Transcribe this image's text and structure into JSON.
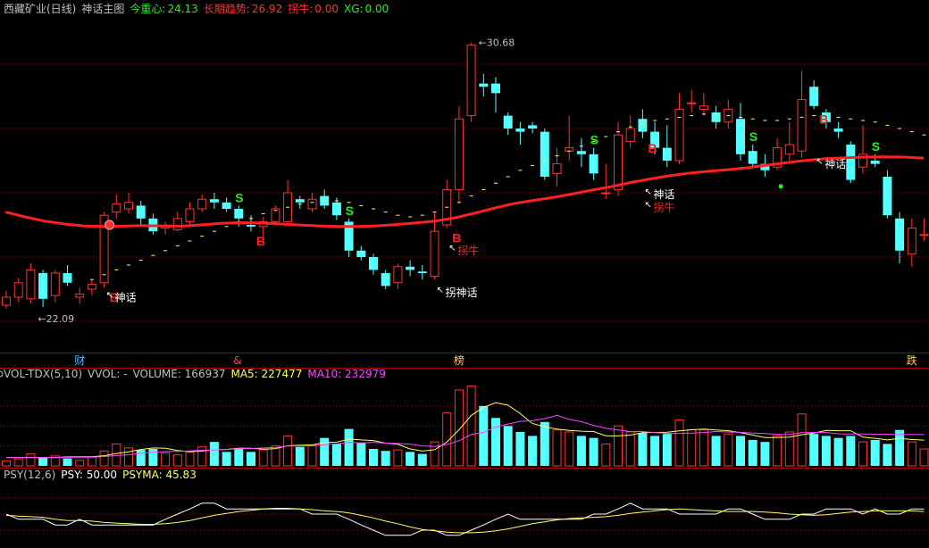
{
  "header": {
    "stock_name": "西藏矿业(日线)",
    "indicator_name": "神话主图",
    "center_label": "今重心:",
    "center_value": "24.13",
    "trend_label": "长期趋势:",
    "trend_value": "26.92",
    "guainiu_label": "拐牛:",
    "guainiu_value": "0.00",
    "xg_label": "XG:",
    "xg_value": "0.00"
  },
  "vol_header": {
    "name": "VOL-TDX(5,10)",
    "vvol": "VVOL: -",
    "volume": "VOLUME: 166937",
    "ma5": "MA5: 227477",
    "ma10": "MA10: 232979"
  },
  "psy_header": {
    "name": "PSY(12,6)",
    "psy": "PSY: 50.00",
    "psyma": "PSYMA: 45.83"
  },
  "colors": {
    "up": "#ff3232",
    "down": "#54ffff",
    "trend": "#ff2020",
    "dots": "#ffff66",
    "ma5": "#ffff66",
    "ma10": "#ff44ff",
    "psy": "#ffffff",
    "psyma": "#ffff66",
    "grid": "#8b0000",
    "signal_s": "#22ee22",
    "signal_b": "#ff2020",
    "label": "#ffffff"
  },
  "chart_data": {
    "type": "candlestick",
    "ylim": [
      21,
      31.5
    ],
    "vol_max": 420000,
    "psy_range": [
      0,
      100
    ],
    "candles": [
      [
        22.5,
        22.75,
        22.4,
        22.95
      ],
      [
        22.75,
        23.2,
        22.6,
        23.35
      ],
      [
        22.7,
        23.6,
        22.55,
        23.8
      ],
      [
        23.5,
        22.7,
        22.45,
        23.6
      ],
      [
        22.8,
        23.5,
        22.6,
        23.6
      ],
      [
        23.5,
        23.2,
        23.1,
        23.75
      ],
      [
        22.75,
        22.85,
        22.55,
        23.05
      ],
      [
        23.0,
        23.15,
        22.8,
        23.3
      ],
      [
        23.2,
        25.3,
        23.05,
        25.4
      ],
      [
        25.4,
        25.65,
        25.2,
        25.95
      ],
      [
        25.5,
        25.7,
        25.35,
        26.0
      ],
      [
        25.6,
        25.2,
        25.0,
        25.75
      ],
      [
        25.2,
        24.8,
        24.7,
        25.35
      ],
      [
        24.9,
        24.95,
        24.7,
        25.1
      ],
      [
        24.85,
        25.2,
        24.8,
        25.4
      ],
      [
        25.1,
        25.5,
        25.0,
        25.7
      ],
      [
        25.5,
        25.8,
        25.4,
        25.95
      ],
      [
        25.8,
        25.7,
        25.5,
        26.0
      ],
      [
        25.7,
        25.5,
        25.4,
        25.85
      ],
      [
        25.5,
        25.2,
        24.95,
        25.6
      ],
      [
        25.0,
        24.95,
        24.8,
        25.3
      ],
      [
        24.95,
        25.1,
        24.6,
        25.25
      ],
      [
        25.1,
        25.5,
        25.0,
        25.6
      ],
      [
        25.1,
        26.0,
        25.0,
        26.4
      ],
      [
        25.8,
        25.7,
        25.5,
        25.9
      ],
      [
        25.5,
        25.8,
        25.4,
        26.0
      ],
      [
        25.9,
        25.6,
        25.5,
        26.1
      ],
      [
        25.7,
        25.3,
        25.15,
        25.85
      ],
      [
        25.1,
        24.2,
        24.0,
        25.2
      ],
      [
        24.2,
        24.0,
        23.9,
        24.35
      ],
      [
        24.0,
        23.6,
        23.45,
        24.1
      ],
      [
        23.5,
        23.1,
        23.0,
        23.6
      ],
      [
        23.2,
        23.7,
        23.0,
        23.8
      ],
      [
        23.7,
        23.6,
        23.4,
        23.9
      ],
      [
        23.55,
        23.5,
        23.3,
        23.75
      ],
      [
        23.4,
        24.8,
        23.3,
        25.4
      ],
      [
        25.0,
        26.1,
        24.9,
        26.4
      ],
      [
        26.1,
        28.3,
        25.7,
        28.7
      ],
      [
        28.4,
        30.6,
        28.2,
        30.68
      ],
      [
        29.4,
        29.3,
        29.0,
        29.7
      ],
      [
        29.4,
        29.1,
        28.5,
        29.6
      ],
      [
        28.4,
        28.0,
        27.8,
        28.5
      ],
      [
        28.0,
        27.9,
        27.5,
        28.2
      ],
      [
        28.1,
        28.0,
        27.85,
        28.2
      ],
      [
        27.9,
        26.5,
        26.4,
        28.0
      ],
      [
        26.6,
        26.9,
        26.2,
        27.4
      ],
      [
        27.3,
        27.4,
        27.0,
        28.4
      ],
      [
        27.3,
        27.2,
        26.8,
        27.7
      ],
      [
        27.2,
        26.6,
        26.4,
        27.4
      ],
      [
        26.0,
        26.0,
        25.8,
        26.9
      ],
      [
        26.1,
        27.8,
        25.9,
        28.2
      ],
      [
        27.6,
        28.0,
        27.4,
        28.4
      ],
      [
        28.3,
        27.9,
        27.7,
        28.6
      ],
      [
        27.9,
        27.4,
        27.2,
        28.2
      ],
      [
        27.4,
        27.0,
        26.8,
        28.1
      ],
      [
        27.0,
        28.6,
        26.9,
        29.1
      ],
      [
        28.8,
        28.8,
        28.5,
        29.2
      ],
      [
        28.6,
        28.7,
        28.4,
        29.1
      ],
      [
        28.5,
        28.2,
        28.0,
        28.7
      ],
      [
        28.2,
        28.6,
        28.0,
        28.9
      ],
      [
        28.3,
        27.2,
        27.0,
        28.8
      ],
      [
        27.3,
        26.9,
        26.8,
        27.5
      ],
      [
        26.9,
        26.7,
        26.5,
        27.2
      ],
      [
        26.8,
        27.4,
        26.7,
        27.7
      ],
      [
        27.2,
        27.5,
        27.0,
        28.2
      ],
      [
        27.3,
        28.9,
        27.1,
        29.8
      ],
      [
        29.3,
        28.7,
        28.6,
        29.5
      ],
      [
        28.5,
        28.2,
        28.0,
        28.6
      ],
      [
        28.0,
        27.9,
        27.7,
        28.2
      ],
      [
        27.5,
        26.4,
        26.3,
        27.6
      ],
      [
        26.8,
        27.2,
        26.6,
        28.1
      ],
      [
        27.0,
        26.9,
        26.8,
        27.2
      ],
      [
        26.5,
        25.3,
        25.2,
        26.7
      ],
      [
        25.2,
        24.2,
        23.8,
        25.4
      ],
      [
        24.1,
        24.9,
        23.7,
        25.2
      ],
      [
        24.7,
        24.7,
        24.5,
        25.2
      ]
    ],
    "trend": [
      25.4,
      25.25,
      25.12,
      25.03,
      24.97,
      24.95,
      24.96,
      24.98,
      24.97,
      24.96,
      25.0,
      25.05,
      25.07,
      25.06,
      25.03,
      25.0,
      24.97,
      24.95,
      24.95,
      24.97,
      25.01,
      25.06,
      25.12,
      25.22,
      25.36,
      25.52,
      25.66,
      25.76,
      25.85,
      25.96,
      26.08,
      26.19,
      26.32,
      26.43,
      26.53,
      26.61,
      26.67,
      26.72,
      26.78,
      26.86,
      26.94,
      27.01,
      27.06,
      27.09,
      27.11,
      27.12,
      27.11,
      27.08
    ],
    "dots": [
      [
        7,
        23.3
      ],
      [
        8,
        23.45
      ],
      [
        9,
        23.6
      ],
      [
        10,
        23.75
      ],
      [
        11,
        23.9
      ],
      [
        12,
        24.05
      ],
      [
        13,
        24.2
      ],
      [
        14,
        24.35
      ],
      [
        15,
        24.5
      ],
      [
        16,
        24.65
      ],
      [
        17,
        24.8
      ],
      [
        18,
        24.95
      ],
      [
        19,
        25.1
      ],
      [
        20,
        25.2
      ],
      [
        21,
        25.35
      ],
      [
        22,
        25.45
      ],
      [
        23,
        25.55
      ],
      [
        24,
        25.65
      ],
      [
        25,
        25.7
      ],
      [
        26,
        25.75
      ],
      [
        27,
        25.75
      ],
      [
        28,
        25.7
      ],
      [
        29,
        25.6
      ],
      [
        30,
        25.5
      ],
      [
        31,
        25.4
      ],
      [
        32,
        25.3
      ],
      [
        33,
        25.25
      ],
      [
        34,
        25.3
      ],
      [
        35,
        25.4
      ],
      [
        36,
        25.55
      ],
      [
        37,
        25.7
      ],
      [
        38,
        25.9
      ],
      [
        39,
        26.1
      ],
      [
        40,
        26.3
      ],
      [
        41,
        26.5
      ],
      [
        42,
        26.7
      ],
      [
        43,
        26.85
      ],
      [
        44,
        27.0
      ],
      [
        45,
        27.15
      ],
      [
        46,
        27.3
      ],
      [
        47,
        27.45
      ],
      [
        48,
        27.6
      ],
      [
        49,
        27.75
      ],
      [
        50,
        27.9
      ],
      [
        51,
        28.05
      ],
      [
        52,
        28.15
      ],
      [
        53,
        28.25
      ],
      [
        54,
        28.3
      ],
      [
        55,
        28.35
      ],
      [
        56,
        28.4
      ],
      [
        57,
        28.45
      ],
      [
        58,
        28.45
      ],
      [
        59,
        28.4
      ],
      [
        60,
        28.35
      ],
      [
        61,
        28.3
      ],
      [
        62,
        28.25
      ],
      [
        63,
        28.25
      ],
      [
        64,
        28.3
      ],
      [
        65,
        28.35
      ],
      [
        66,
        28.4
      ],
      [
        67,
        28.4
      ],
      [
        68,
        28.35
      ],
      [
        69,
        28.3
      ],
      [
        70,
        28.25
      ],
      [
        71,
        28.2
      ],
      [
        72,
        28.1
      ],
      [
        73,
        28.0
      ],
      [
        74,
        27.9
      ],
      [
        75,
        27.8
      ]
    ],
    "volume": [
      25000,
      35000,
      60000,
      40000,
      50000,
      38000,
      28000,
      45000,
      75000,
      110000,
      90000,
      80000,
      85000,
      65000,
      55000,
      70000,
      95000,
      120000,
      70000,
      85000,
      70000,
      80000,
      100000,
      150000,
      95000,
      100000,
      140000,
      110000,
      185000,
      115000,
      85000,
      75000,
      80000,
      70000,
      60000,
      120000,
      265000,
      380000,
      400000,
      300000,
      240000,
      200000,
      170000,
      150000,
      220000,
      180000,
      170000,
      150000,
      140000,
      110000,
      200000,
      170000,
      165000,
      150000,
      160000,
      230000,
      180000,
      180000,
      150000,
      160000,
      150000,
      130000,
      120000,
      150000,
      170000,
      260000,
      160000,
      150000,
      140000,
      150000,
      120000,
      130000,
      110000,
      180000,
      120000,
      85000
    ],
    "ma5": [
      42000,
      42000,
      42000,
      42000,
      42000,
      45000,
      46000,
      46000,
      51000,
      62000,
      70000,
      82000,
      90000,
      88000,
      77000,
      71000,
      74000,
      81000,
      82000,
      89000,
      88000,
      84000,
      86000,
      101000,
      103000,
      105000,
      117000,
      119000,
      134000,
      130000,
      127000,
      114000,
      108000,
      85000,
      74000,
      81000,
      119000,
      181000,
      253000,
      293000,
      317000,
      304000,
      262000,
      212000,
      196000,
      184000,
      178000,
      174000,
      172000,
      150000,
      150000,
      154000,
      167000,
      167000,
      169000,
      175000,
      181000,
      184000,
      180000,
      176000,
      166000,
      154000,
      142000,
      142000,
      144000,
      156000,
      164000,
      178000,
      176000,
      176000,
      144000,
      138000,
      130000,
      138000,
      132000,
      129000
    ],
    "ma10": [
      42000,
      42000,
      42000,
      42000,
      42000,
      43000,
      44000,
      44000,
      47000,
      52000,
      56000,
      63000,
      68000,
      72000,
      73000,
      75000,
      78000,
      80000,
      82000,
      86000,
      87000,
      90000,
      92000,
      99000,
      100000,
      101000,
      106000,
      110000,
      118000,
      115000,
      118000,
      114000,
      112000,
      109000,
      100000,
      97000,
      107000,
      126000,
      157000,
      168000,
      194000,
      210000,
      223000,
      226000,
      237000,
      253000,
      233000,
      221000,
      203000,
      188000,
      180000,
      172000,
      172000,
      166000,
      163000,
      162000,
      164000,
      167000,
      172000,
      170000,
      168000,
      164000,
      162000,
      158000,
      157000,
      166000,
      167000,
      167000,
      161000,
      160000,
      160000,
      159000,
      158000,
      157000,
      157000,
      157000
    ],
    "psy": [
      50,
      42,
      42,
      42,
      33,
      33,
      42,
      33,
      33,
      33,
      33,
      33,
      33,
      42,
      50,
      58,
      67,
      67,
      58,
      58,
      58,
      58,
      58,
      58,
      58,
      50,
      50,
      50,
      42,
      33,
      25,
      17,
      17,
      17,
      25,
      25,
      17,
      17,
      25,
      33,
      42,
      50,
      42,
      42,
      42,
      42,
      42,
      42,
      50,
      50,
      58,
      67,
      58,
      58,
      58,
      50,
      50,
      50,
      50,
      58,
      58,
      50,
      42,
      42,
      42,
      50,
      50,
      58,
      58,
      58,
      50,
      58,
      50,
      50,
      58,
      58
    ],
    "psyma": [
      48,
      47,
      46,
      45,
      42,
      40,
      40,
      39,
      37,
      36,
      35,
      34,
      34,
      35,
      37,
      40,
      44,
      48,
      51,
      54,
      56,
      58,
      59,
      59,
      58,
      57,
      55,
      54,
      52,
      48,
      44,
      39,
      35,
      30,
      26,
      24,
      22,
      21,
      21,
      22,
      24,
      27,
      31,
      35,
      38,
      41,
      43,
      44,
      45,
      46,
      48,
      51,
      53,
      55,
      57,
      58,
      57,
      56,
      55,
      54,
      54,
      54,
      53,
      52,
      50,
      49,
      48,
      49,
      51,
      53,
      54,
      55,
      55,
      55,
      55,
      54
    ],
    "signals": [
      {
        "i": 8,
        "type": "B"
      },
      {
        "i": 19,
        "type": "S"
      },
      {
        "i": 20,
        "type": "B"
      },
      {
        "i": 28,
        "type": "S"
      },
      {
        "i": 36,
        "type": "B"
      },
      {
        "i": 48,
        "type": "S"
      },
      {
        "i": 52,
        "type": "B"
      },
      {
        "i": 61,
        "type": "S"
      },
      {
        "i": 66,
        "type": "B"
      },
      {
        "i": 71,
        "type": "S"
      }
    ],
    "annotations": [
      {
        "i": 8,
        "price": 22.85,
        "text": "神话",
        "color": "#ffffff"
      },
      {
        "i": 35,
        "price": 23.0,
        "text": "拐神话",
        "color": "#ffffff"
      },
      {
        "i": 36,
        "price": 24.3,
        "text": "拐牛",
        "color": "#ff2020"
      },
      {
        "i": 52,
        "price": 26.05,
        "text": "神话",
        "color": "#ffffff"
      },
      {
        "i": 52,
        "price": 25.65,
        "text": "拐牛",
        "color": "#ff2020"
      },
      {
        "i": 66,
        "price": 27.0,
        "text": "神话",
        "color": "#ffffff"
      }
    ],
    "price_labels": [
      {
        "i": 2,
        "price": 22.09,
        "text": "22.09"
      },
      {
        "i": 38,
        "price": 30.68,
        "text": "30.68"
      }
    ],
    "bottom_markers": [
      {
        "i": 6,
        "text": "财",
        "color": "#5ab4ff"
      },
      {
        "i": 19,
        "text": "&",
        "color": "#ff4444"
      },
      {
        "i": 37,
        "text": "榜",
        "color": "#ffcc66"
      },
      {
        "i": 74,
        "text": "跌",
        "color": "#ffcc66"
      }
    ]
  }
}
